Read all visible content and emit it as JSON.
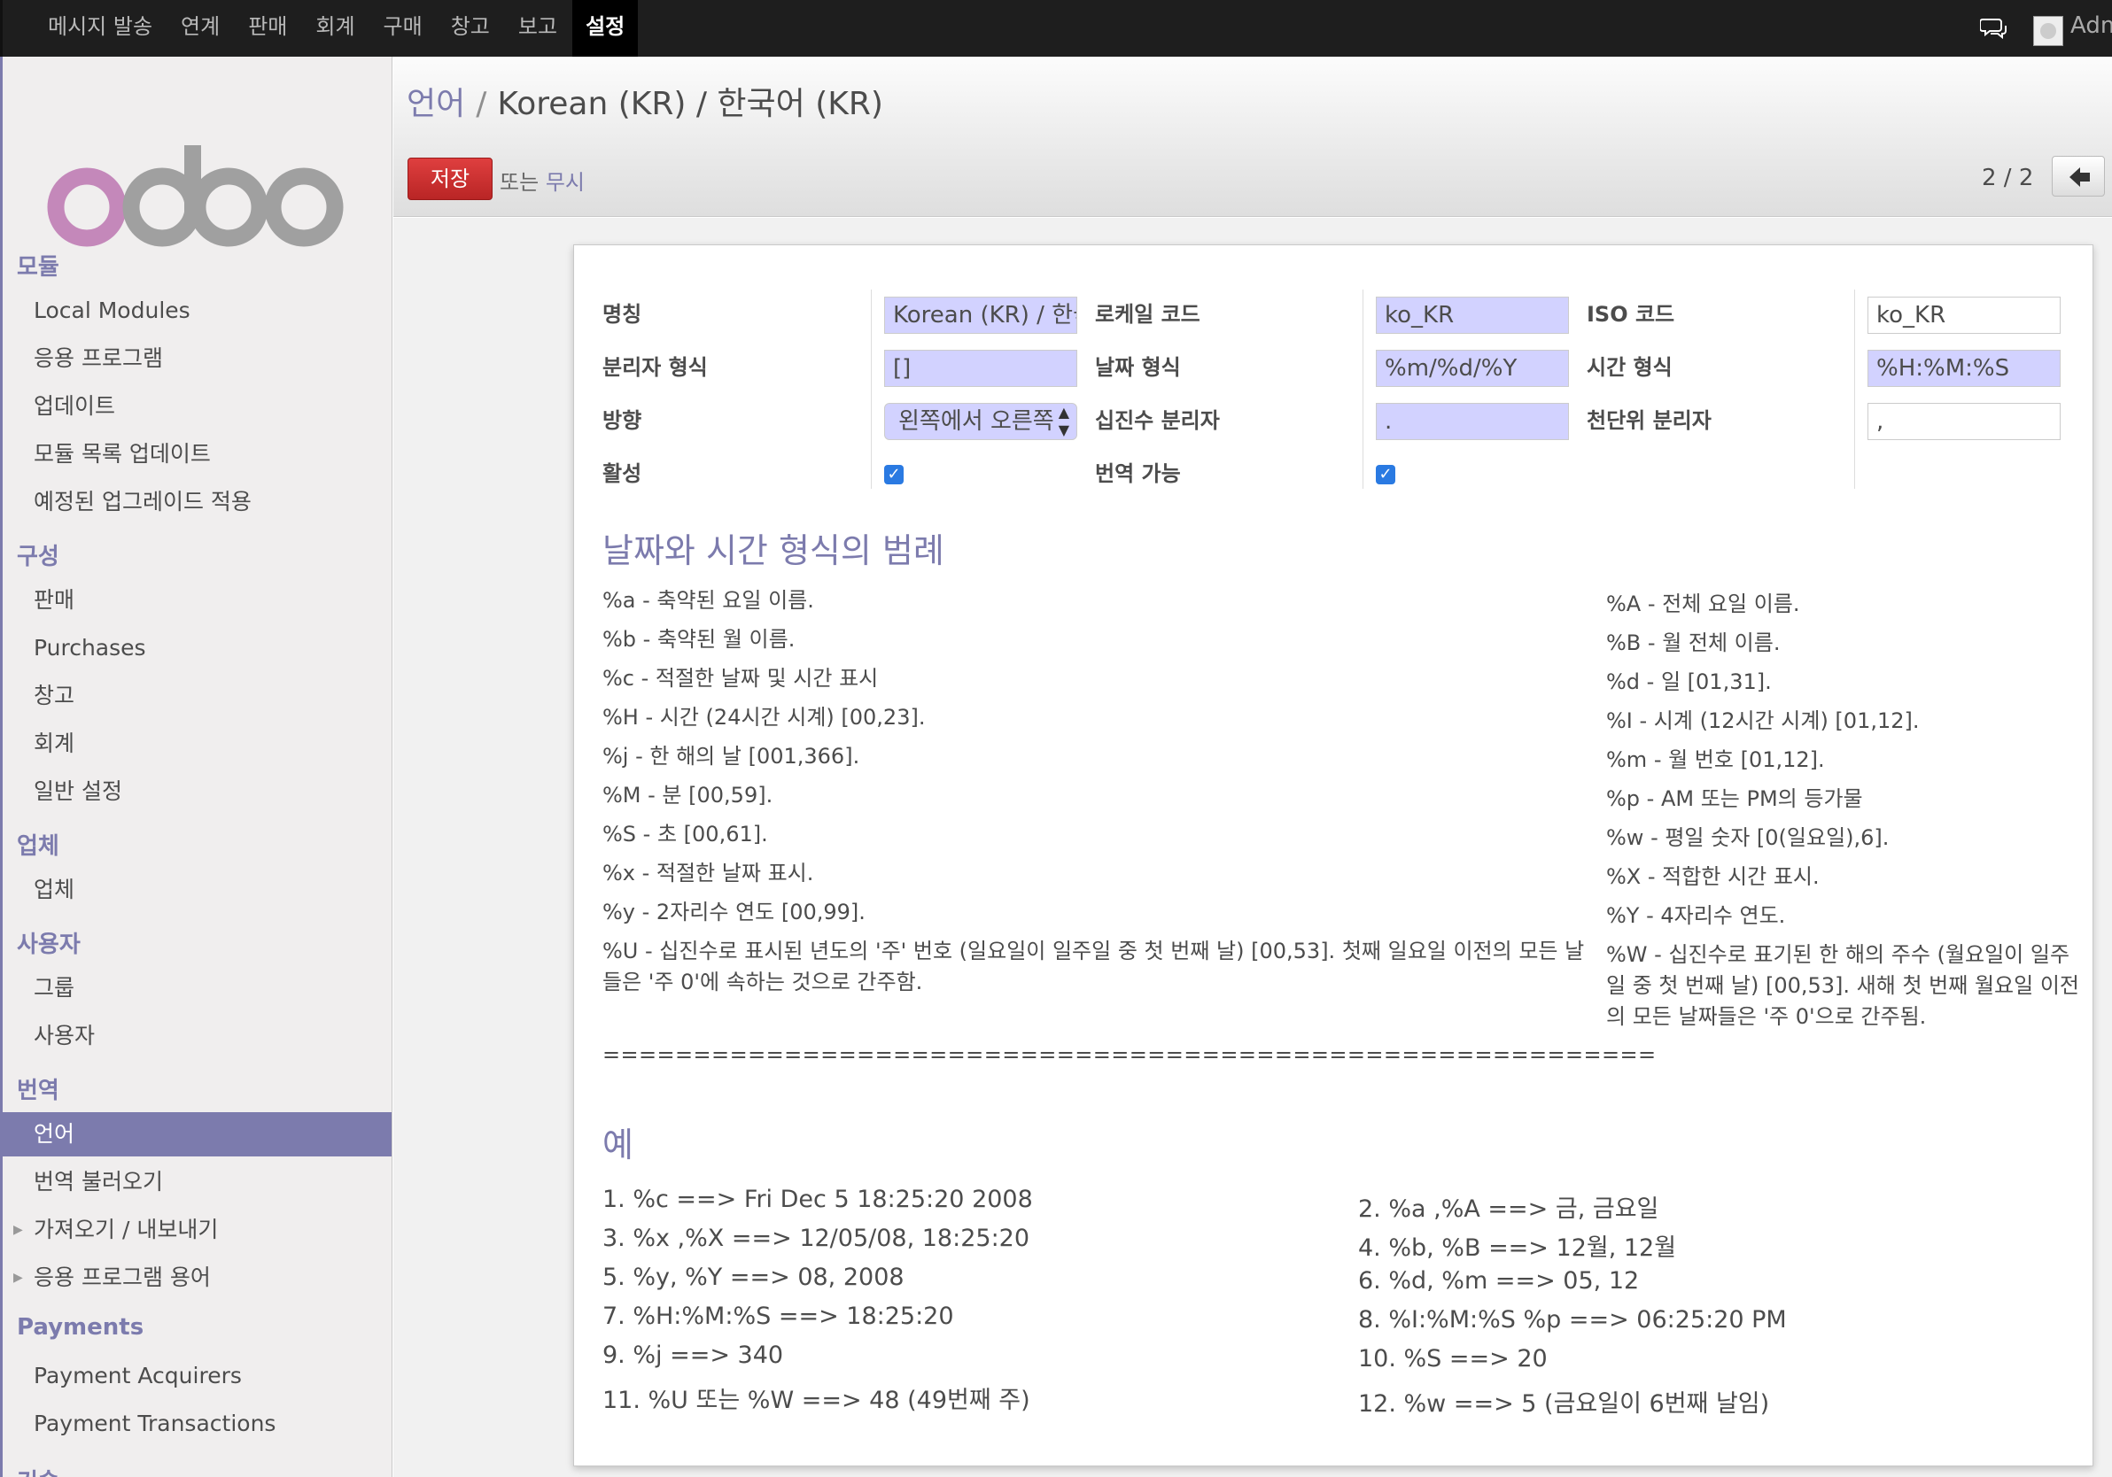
{
  "topbar": {
    "menu": [
      "메시지 발송",
      "연계",
      "판매",
      "회계",
      "구매",
      "창고",
      "보고",
      "설정"
    ],
    "active_index": 7,
    "user": "Adm"
  },
  "sidebar": {
    "logo_text": "odoo",
    "sections": [
      {
        "title": "모듈",
        "items": [
          "Local Modules",
          "응용 프로그램",
          "업데이트",
          "모듈 목록 업데이트",
          "예정된 업그레이드 적용"
        ]
      },
      {
        "title": "구성",
        "items": [
          "판매",
          "Purchases",
          "창고",
          "회계",
          "일반 설정"
        ]
      },
      {
        "title": "업체",
        "items": [
          "업체"
        ]
      },
      {
        "title": "사용자",
        "items": [
          "그룹",
          "사용자"
        ]
      },
      {
        "title": "번역",
        "items": [
          "언어",
          "번역 불러오기",
          "가져오기 / 내보내기",
          "응용 프로그램 용어"
        ]
      },
      {
        "title": "Payments",
        "items": [
          "Payment Acquirers",
          "Payment Transactions"
        ]
      },
      {
        "title": "기술",
        "items": []
      }
    ],
    "active_item": "언어"
  },
  "header": {
    "breadcrumb_parent": "언어",
    "breadcrumb_sep": "/",
    "breadcrumb_current": "Korean (KR) / 한국어 (KR)",
    "save_label": "저장",
    "or_label": "또는",
    "discard_label": "무시",
    "pager": "2 / 2"
  },
  "form": {
    "name_label": "명칭",
    "name_value": "Korean (KR) / 한국어 (KR)",
    "locale_label": "로케일 코드",
    "locale_value": "ko_KR",
    "iso_label": "ISO 코드",
    "iso_value": "ko_KR",
    "grouping_label": "분리자 형식",
    "grouping_value": "[]",
    "date_label": "날짜 형식",
    "date_value": "%m/%d/%Y",
    "time_label": "시간 형식",
    "time_value": "%H:%M:%S",
    "direction_label": "방향",
    "direction_value": "왼쪽에서 오른쪽",
    "decimal_label": "십진수 분리자",
    "decimal_value": ".",
    "thousands_label": "천단위 분리자",
    "thousands_value": ",",
    "active_label": "활성",
    "active_checked": true,
    "translatable_label": "번역 가능",
    "translatable_checked": true
  },
  "legend": {
    "title": "날짜와 시간 형식의 범례",
    "left": [
      "%a - 축약된 요일 이름.",
      "%b - 축약된 월 이름.",
      "%c - 적절한 날짜 및 시간 표시",
      "%H - 시간 (24시간 시계) [00,23].",
      "%j - 한 해의 날 [001,366].",
      "%M - 분 [00,59].",
      "%S - 초 [00,61].",
      "%x - 적절한 날짜 표시.",
      "%y - 2자리수 연도 [00,99].",
      "%U - 십진수로 표시된 년도의 '주' 번호 (일요일이 일주일 중 첫 번째 날) [00,53]. 첫째 일요일 이전의 모든 날들은 '주 0'에 속하는 것으로 간주함."
    ],
    "right": [
      "%A - 전체 요일 이름.",
      "%B - 월 전체 이름.",
      "%d - 일 [01,31].",
      "%I - 시계 (12시간 시계) [01,12].",
      "%m - 월 번호 [01,12].",
      "%p - AM 또는 PM의 등가물",
      "%w - 평일 숫자 [0(일요일),6].",
      "%X - 적합한 시간 표시.",
      "%Y - 4자리수 연도.",
      "%W - 십진수로 표기된 한 해의 주수 (월요일이 일주일 중 첫 번째 날) [00,53]. 새해 첫 번째 월요일 이전의 모든 날짜들은 '주 0'으로 간주됨."
    ],
    "separator": "=========================================================="
  },
  "examples": {
    "title": "예",
    "left": [
      "1. %c ==> Fri Dec 5 18:25:20 2008",
      "3. %x ,%X ==> 12/05/08, 18:25:20",
      "5. %y, %Y ==> 08, 2008",
      "7. %H:%M:%S ==> 18:25:20",
      "9. %j ==> 340",
      "11. %U 또는 %W ==> 48 (49번째 주)"
    ],
    "right": [
      "2. %a ,%A ==> 금, 금요일",
      "4. %b, %B ==> 12월, 12월",
      "6. %d, %m ==> 05, 12",
      "8. %I:%M:%S %p ==> 06:25:20 PM",
      "10. %S ==> 20",
      "12. %w ==> 5 (금요일이 6번째 날임)"
    ]
  }
}
